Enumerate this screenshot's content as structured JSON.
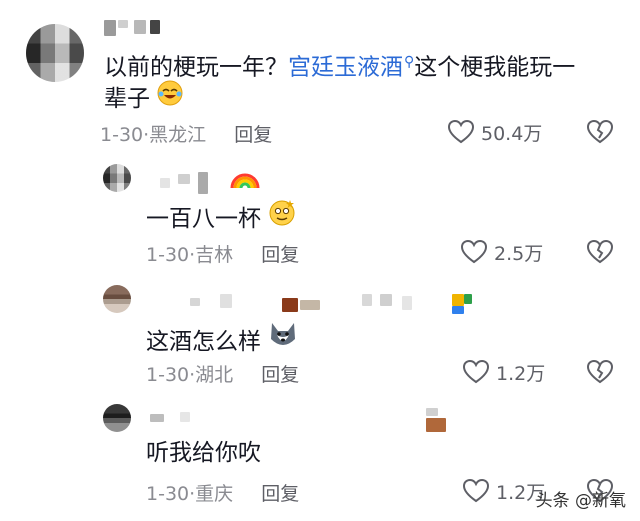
{
  "comments": [
    {
      "text_plain": "以前的梗玩一年？",
      "text_link": "宫廷玉液酒",
      "text_rest": "这个梗我能玩一",
      "text_line2": "辈子",
      "emoji": "laughing-crying-emoji",
      "date": "1-30",
      "location": "黑龙江",
      "reply_label": "回复",
      "likes": "50.4万"
    },
    {
      "text": "一百八一杯",
      "emoji": "dizzy-smile-emoji",
      "date": "1-30",
      "location": "吉林",
      "reply_label": "回复",
      "likes": "2.5万"
    },
    {
      "text": "这酒怎么样",
      "emoji": "husky-emoji",
      "date": "1-30",
      "location": "湖北",
      "reply_label": "回复",
      "likes": "1.2万"
    },
    {
      "text": "听我给你吹",
      "date": "1-30",
      "location": "重庆",
      "reply_label": "回复",
      "likes": "1.2万"
    }
  ],
  "watermark": "头条 @新氧",
  "colors": {
    "link": "#2c6bd6",
    "meta": "#8a8b91",
    "text": "#161823"
  }
}
